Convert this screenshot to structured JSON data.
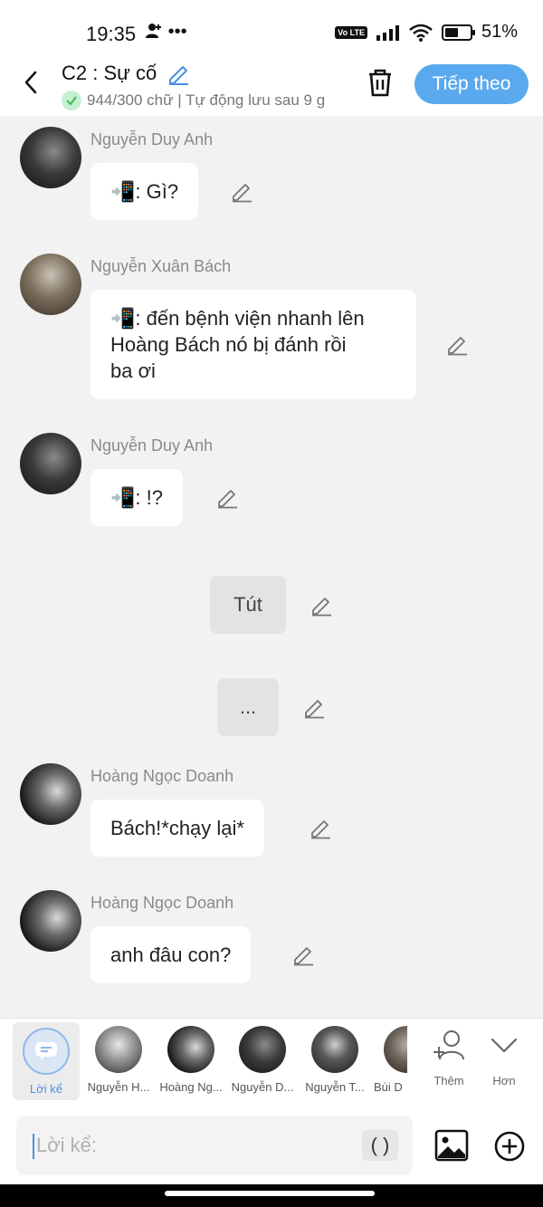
{
  "status_bar": {
    "time": "19:35",
    "extra": "•••",
    "battery": "51%",
    "volte": "Vo LTE"
  },
  "header": {
    "title": "C2 : Sự cố",
    "subtitle": "944/300 chữ | Tự động lưu sau 9 g",
    "next_label": "Tiếp theo"
  },
  "messages": [
    {
      "sender": "Nguyễn Duy Anh",
      "text": "📲: Gì?"
    },
    {
      "sender": "Nguyễn Xuân Bách",
      "text_lines": [
        "📲: đến bệnh viện nhanh lên",
        "Hoàng Bách nó bị đánh rồi",
        "ba ơi"
      ]
    },
    {
      "sender": "Nguyễn Duy Anh",
      "text": "📲: !?"
    },
    {
      "narration": "Tút"
    },
    {
      "narration": "..."
    },
    {
      "sender": "Hoàng Ngọc Doanh",
      "text": "Bách!*chạy lại*"
    },
    {
      "sender": "Hoàng Ngọc Doanh",
      "text": "anh đâu con?"
    }
  ],
  "character_bar": {
    "narrator_label": "Lời kể",
    "characters": [
      "Nguyễn H...",
      "Hoàng Ng...",
      "Nguyễn D...",
      "Nguyễn T...",
      "Bùi D"
    ],
    "add_label": "Thêm",
    "more_label": "Hơn"
  },
  "input": {
    "placeholder": "Lời kể:",
    "paren": "( )"
  },
  "colors": {
    "accent": "#5aa9ee",
    "background": "#f2f2f2",
    "bubble": "#ffffff",
    "check": "#3fbf63"
  }
}
